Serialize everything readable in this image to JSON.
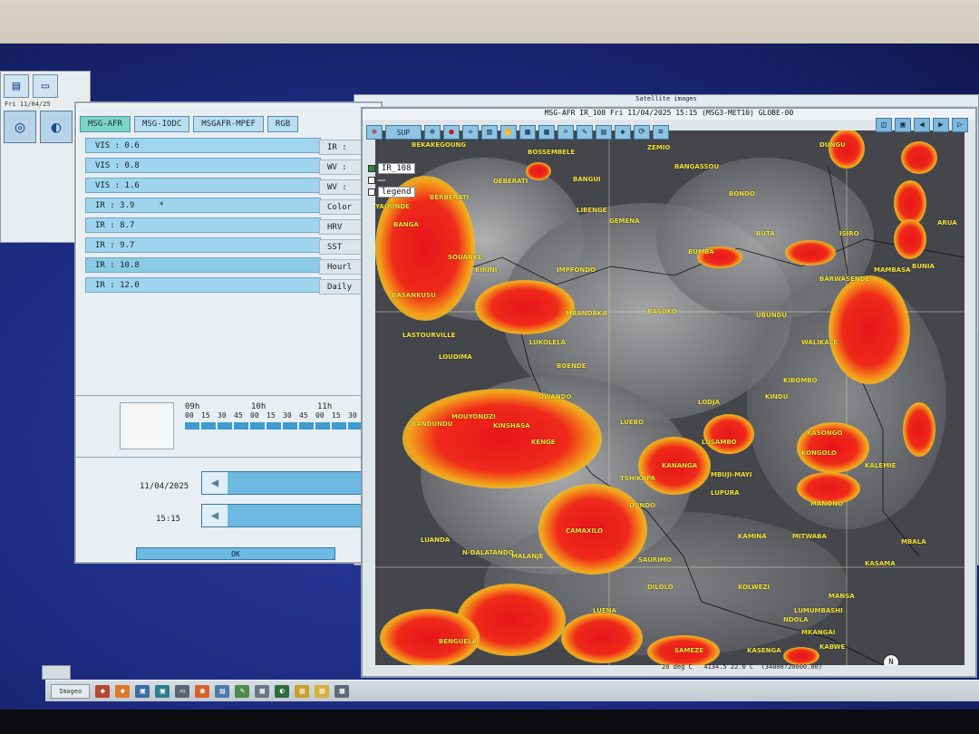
{
  "mini_window": {
    "date": "Fri 11/04/25"
  },
  "panel": {
    "tabs": [
      "MSG-AFR",
      "MSG-IODC",
      "MSGAFR-MPEF",
      "RGB"
    ],
    "channels": [
      "VIS : 0.6",
      "VIS : 0.8",
      "VIS : 1.6",
      "IR : 3.9     *",
      "IR : 8.7",
      "IR : 9.7",
      "IR : 10.8",
      "IR : 12.0"
    ],
    "channels_right": [
      "IR :",
      "WV :",
      "WV :",
      "Color",
      "HRV",
      "SST",
      "Hourl",
      "Daily"
    ],
    "timeline_hours": [
      "09h",
      "10h",
      "11h"
    ],
    "timeline_mins": [
      "00",
      "15",
      "30",
      "45",
      "00",
      "15",
      "30",
      "45",
      "00",
      "15",
      "30",
      "4"
    ],
    "date_value": "11/04/2025",
    "time_value": "15:15",
    "ok_label": "OK"
  },
  "sat_window": {
    "title": "Satellite images"
  },
  "map_window": {
    "title": "MSG-AFR IR_108 Fri 11/04/2025 15:15 (MSG3-MET10) GLOBE-00",
    "sup_label": "SUP",
    "layers": [
      "IR_108",
      "",
      "legend"
    ],
    "status": "20 deg C   4134.5 22.0 C  (34000720000.00)",
    "north": "N"
  },
  "places": [
    "BEKAKEGOUNG",
    "BOSSEMBELE",
    "DEBERATI",
    "BANGUI",
    "ZEMIO",
    "DUNGU",
    "BANGASSOU",
    "BONDO",
    "BERBERATI",
    "LIBENGE",
    "GEMENA",
    "BUTA",
    "ISIRO",
    "ARUA",
    "BANGA",
    "YAOUNDE",
    "SOUANKE",
    "IMPFONDO",
    "BUMBA",
    "BARWASENDE",
    "MAMBASA",
    "BUNIA",
    "MBANDAKA",
    "BASOKO",
    "BIRINI",
    "BASANKUSU",
    "UBUNDU",
    "LASTOURVILLE",
    "LOUDIMA",
    "LUKOLELA",
    "BOENDE",
    "WALIKALE",
    "KINDU",
    "KIBOMBO",
    "LODJA",
    "OWANDO",
    "MOUYONDZI",
    "KINSHASA",
    "BANDUNDU",
    "KENGE",
    "LUEBO",
    "KASONGO",
    "LUSAMBO",
    "KANANGA",
    "TSHIKAPA",
    "MBUJI-MAYI",
    "KONGOLO",
    "KALEMIE",
    "LUPURA",
    "DUNDO",
    "MANONO",
    "CAMAXILO",
    "LUANDA",
    "N-DALATANDO",
    "MALANJE",
    "KAMINA",
    "MITWABA",
    "SAURIMO",
    "DILOLO",
    "KOLWEZI",
    "LUMUMBASHI",
    "MANSA",
    "KASAMA",
    "LUENA",
    "MBALA",
    "SAMEZE",
    "KASENGA",
    "KABWE",
    "MKANGAI",
    "NDOLA",
    "BENGUELA"
  ],
  "taskbar": {
    "items": [
      "Imageo",
      "Satellite images"
    ]
  }
}
